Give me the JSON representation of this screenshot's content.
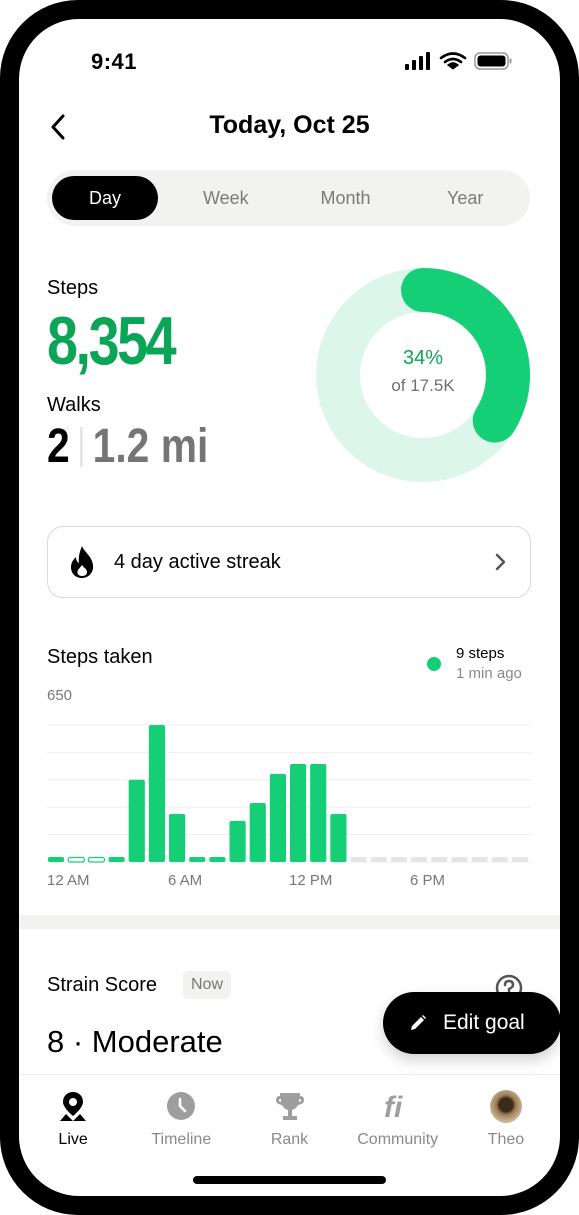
{
  "status_bar": {
    "time": "9:41"
  },
  "header": {
    "title": "Today, Oct 25",
    "back_icon": "chevron-left-icon"
  },
  "period_tabs": [
    {
      "label": "Day",
      "active": true
    },
    {
      "label": "Week",
      "active": false
    },
    {
      "label": "Month",
      "active": false
    },
    {
      "label": "Year",
      "active": false
    }
  ],
  "summary": {
    "steps_label": "Steps",
    "steps_value": "8,354",
    "walks_label": "Walks",
    "walks_count": "2",
    "walks_distance": "1.2 mi",
    "goal_percent_text": "34%",
    "goal_text": "of 17.5K",
    "goal_progress": 0.34
  },
  "streak": {
    "icon": "flame-icon",
    "label": "4 day active streak"
  },
  "chart_data": {
    "type": "bar",
    "title": "Steps taken",
    "ylim": [
      0,
      650
    ],
    "y_tick_label": "650",
    "x_tick_labels": [
      "12 AM",
      "6 AM",
      "12 PM",
      "6 PM"
    ],
    "categories": [
      "12 AM",
      "1 AM",
      "2 AM",
      "3 AM",
      "4 AM",
      "5 AM",
      "6 AM",
      "7 AM",
      "8 AM",
      "9 AM",
      "10 AM",
      "11 AM",
      "12 PM",
      "1 PM",
      "2 PM",
      "3 PM",
      "4 PM",
      "5 PM",
      "6 PM",
      "7 PM",
      "8 PM",
      "9 PM",
      "10 PM",
      "11 PM"
    ],
    "values": [
      5,
      0,
      0,
      5,
      390,
      650,
      228,
      5,
      5,
      195,
      280,
      418,
      465,
      465,
      228,
      null,
      null,
      null,
      null,
      null,
      null,
      null,
      null,
      null
    ],
    "gridlines": true,
    "latest": {
      "steps": "9 steps",
      "time": "1 min ago"
    }
  },
  "strain": {
    "title": "Strain Score",
    "badge": "Now",
    "value": "8 · Moderate"
  },
  "fab": {
    "label": "Edit goal",
    "icon": "pencil-icon"
  },
  "nav": [
    {
      "label": "Live",
      "icon": "location-pin-icon",
      "active": true
    },
    {
      "label": "Timeline",
      "icon": "clock-icon",
      "active": false
    },
    {
      "label": "Rank",
      "icon": "trophy-icon",
      "active": false
    },
    {
      "label": "Community",
      "icon": "fi-logo-icon",
      "active": false
    },
    {
      "label": "Theo",
      "icon": "avatar",
      "active": false
    }
  ],
  "colors": {
    "accent": "#14cf75",
    "accent_dark": "#0aa556",
    "ring_track": "#dcf7ea",
    "future_bar": "#e5e5e5"
  }
}
